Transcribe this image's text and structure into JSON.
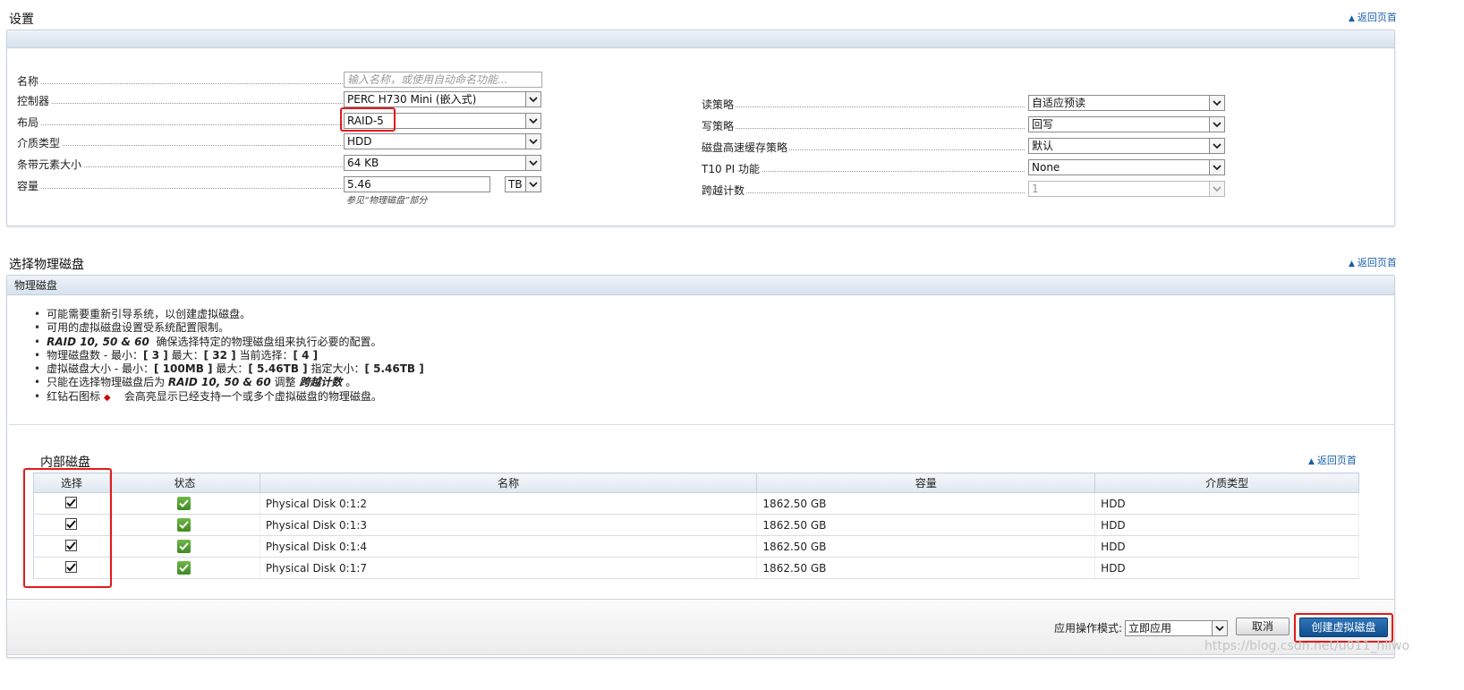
{
  "settings": {
    "title": "设置",
    "back_to_top": "返回页首",
    "left_fields": [
      {
        "label": "名称",
        "placeholder": "输入名称，或使用自动命名功能..."
      },
      {
        "label": "控制器",
        "value": "PERC H730 Mini (嵌入式)"
      },
      {
        "label": "布局",
        "value": "RAID-5"
      },
      {
        "label": "介质类型",
        "value": "HDD"
      },
      {
        "label": "条带元素大小",
        "value": "64 KB"
      },
      {
        "label": "容量",
        "value": "5.46",
        "unit": "TB",
        "hint": "参见“物理磁盘”部分"
      }
    ],
    "right_fields": [
      {
        "label": "读策略",
        "value": "自适应预读"
      },
      {
        "label": "写策略",
        "value": "回写"
      },
      {
        "label": "磁盘高速缓存策略",
        "value": "默认"
      },
      {
        "label": "T10 PI 功能",
        "value": "None"
      },
      {
        "label": "跨越计数",
        "value": "1"
      }
    ]
  },
  "physical": {
    "title": "选择物理磁盘",
    "back_to_top": "返回页首",
    "panel_title": "物理磁盘",
    "notes": {
      "n1": "可能需要重新引导系统，以创建虚拟磁盘。",
      "n2": "可用的虚拟磁盘设置受系统配置限制。",
      "n3_em": "RAID 10, 50 & 60",
      "n3_text": "确保选择特定的物理磁盘组来执行必要的配置。",
      "n4_a": "物理磁盘数 - 最小：",
      "n4_min": "[ 3 ]",
      "n4_b": "最大：",
      "n4_max": "[ 32 ]",
      "n4_c": "当前选择：",
      "n4_cur": "[ 4 ]",
      "n5_a": "虚拟磁盘大小 - 最小：",
      "n5_min": "[ 100MB ]",
      "n5_b": "最大：",
      "n5_max": "[ 5.46TB ]",
      "n5_c": "指定大小：",
      "n5_cur": "[ 5.46TB ]",
      "n6_a": "只能在选择物理磁盘后为",
      "n6_em": "RAID 10, 50 & 60",
      "n6_b": "调整",
      "n6_em2": "跨越计数",
      "n6_end": "。",
      "n7_a": "红钻石图标",
      "n7_b": "会高亮显示已经支持一个或多个虚拟磁盘的物理磁盘。"
    },
    "internal_title": "内部磁盘",
    "internal_back": "返回页首",
    "columns": [
      "选择",
      "状态",
      "名称",
      "容量",
      "介质类型"
    ],
    "rows": [
      {
        "name": "Physical Disk 0:1:2",
        "capacity": "1862.50 GB",
        "media": "HDD",
        "selected": true
      },
      {
        "name": "Physical Disk 0:1:3",
        "capacity": "1862.50 GB",
        "media": "HDD",
        "selected": true
      },
      {
        "name": "Physical Disk 0:1:4",
        "capacity": "1862.50 GB",
        "media": "HDD",
        "selected": true
      },
      {
        "name": "Physical Disk 0:1:7",
        "capacity": "1862.50 GB",
        "media": "HDD",
        "selected": true
      }
    ]
  },
  "footer": {
    "mode_label": "应用操作模式:",
    "mode_value": "立即应用",
    "cancel": "取消",
    "create": "创建虚拟磁盘"
  },
  "watermark": "https://blog.csdn.net/u011_hllwo"
}
